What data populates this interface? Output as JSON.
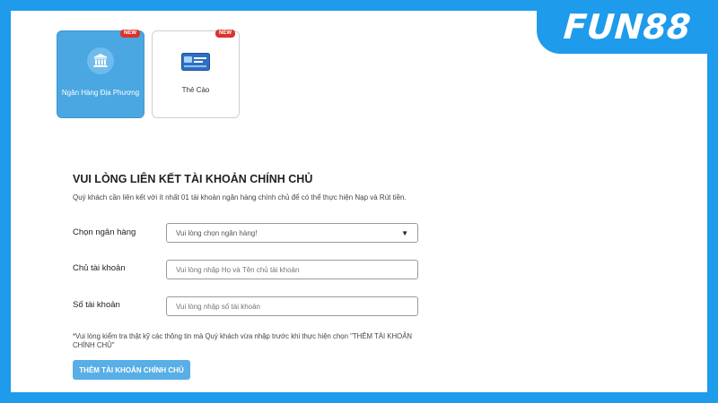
{
  "brand": {
    "logo_text": "FUN88"
  },
  "payment_methods": [
    {
      "label": "Ngân Hàng Địa Phương",
      "badge": "NEW",
      "icon": "bank-icon",
      "selected": true
    },
    {
      "label": "Thẻ Cào",
      "badge": "NEW",
      "icon": "card-icon",
      "selected": false
    }
  ],
  "form": {
    "title": "VUI LÒNG LIÊN KẾT TÀI KHOẢN CHÍNH CHỦ",
    "description": "Quý khách cần liên kết với ít nhất 01 tài khoản ngân hàng chính chủ để có thể thực hiện Nạp và Rút tiền.",
    "bank_label": "Chọn ngân hàng",
    "bank_selected": "Vui lòng chọn ngân hàng!",
    "holder_label": "Chủ tài khoản",
    "holder_placeholder": "Vui lòng nhập Họ và Tên chủ tài khoản",
    "account_label": "Số tài khoản",
    "account_placeholder": "Vui lòng nhập số tài khoản",
    "note": "*Vui lòng kiểm tra thật kỹ các thông tin mà Quý khách vừa nhập trước khi thực hiện chọn \"THÊM TÀI KHOẢN CHÍNH CHỦ\"",
    "submit_label": "THÊM TÀI KHOẢN CHÍNH CHỦ"
  },
  "colors": {
    "brand_blue": "#1e9bea",
    "selected_card": "#4aa7e1",
    "badge_red": "#d9342b",
    "button_blue": "#58aee6"
  }
}
